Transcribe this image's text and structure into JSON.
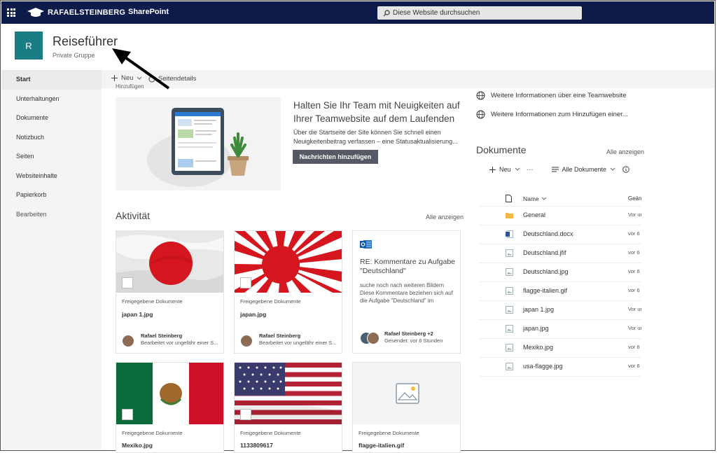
{
  "suite": {
    "brand": "RAFAELSTEINBERG",
    "app": "SharePoint",
    "search_placeholder": "Diese Website durchsuchen"
  },
  "site": {
    "logo_letter": "R",
    "title": "Reiseführer",
    "subtitle": "Private Gruppe"
  },
  "nav": {
    "items": [
      "Start",
      "Unterhaltungen",
      "Dokumente",
      "Notizbuch",
      "Seiten",
      "Websiteinhalte",
      "Papierkorb",
      "Bearbeiten"
    ]
  },
  "command": {
    "new": "Neu",
    "details": "Seitendetails",
    "add": "Hinzufügen"
  },
  "hero": {
    "title": "Halten Sie Ihr Team mit Neuigkeiten auf Ihrer Teamwebsite auf dem Laufenden",
    "text": "Über die Startseite der Site können Sie schnell einen Neuigkeitenbeitrag verfassen – eine Statusaktualisierung...",
    "button": "Nachrichten hinzufügen"
  },
  "activity": {
    "title": "Aktivität",
    "see_all": "Alle anzeigen",
    "cards": [
      {
        "library": "Freigegebene Dokumente",
        "name": "japan 1.jpg",
        "user": "Rafael Steinberg",
        "detail": "Bearbeitet vor ungefähr einer S..."
      },
      {
        "library": "Freigegebene Dokumente",
        "name": "japan.jpg",
        "user": "Rafael Steinberg",
        "detail": "Bearbeitet vor ungefähr einer S..."
      },
      {
        "title": "RE: Kommentare zu Aufgabe \"Deutschland\"",
        "body": "suche noch nach weiteren Bildern Diese Kommentare beziehen sich auf die Aufgabe \"Deutschland\" im",
        "user": "Rafael Steinberg +2",
        "detail": "Gesendet: vor 6 Stunden"
      },
      {
        "library": "Freigegebene Dokumente",
        "name": "Mexiko.jpg"
      },
      {
        "library": "Freigegebene Dokumente",
        "name": "1133809617"
      },
      {
        "library": "Freigegebene Dokumente",
        "name": "flagge-italien.gif"
      }
    ]
  },
  "links": [
    "Weitere Informationen über eine Teamwebsite",
    "Weitere Informationen zum Hinzufügen einer..."
  ],
  "documents": {
    "title": "Dokumente",
    "see_all": "Alle anzeigen",
    "new": "Neu",
    "more": "···",
    "view": "Alle Dokumente",
    "col_name": "Name",
    "col_modified": "Geänd",
    "rows": [
      {
        "name": "General",
        "modified": "Vor ur",
        "type": "folder"
      },
      {
        "name": "Deutschland.docx",
        "modified": "vor 6 :",
        "type": "docx"
      },
      {
        "name": "Deutschland.jfif",
        "modified": "vor 6 :",
        "type": "image"
      },
      {
        "name": "Deutschland.jpg",
        "modified": "vor 6 :",
        "type": "image"
      },
      {
        "name": "flagge-italien.gif",
        "modified": "vor 6 :",
        "type": "image"
      },
      {
        "name": "japan 1.jpg",
        "modified": "Vor ur",
        "type": "image"
      },
      {
        "name": "japan.jpg",
        "modified": "Vor ur",
        "type": "image"
      },
      {
        "name": "Mexiko.jpg",
        "modified": "vor 6 :",
        "type": "image"
      },
      {
        "name": "usa-flagge.jpg",
        "modified": "vor 6 :",
        "type": "image"
      }
    ]
  },
  "colors": {
    "suite_bg": "#0d1b4b",
    "logo_bg": "#1a7c84",
    "button_bg": "#555b66",
    "folder": "#f5b942",
    "word": "#2b579a"
  }
}
